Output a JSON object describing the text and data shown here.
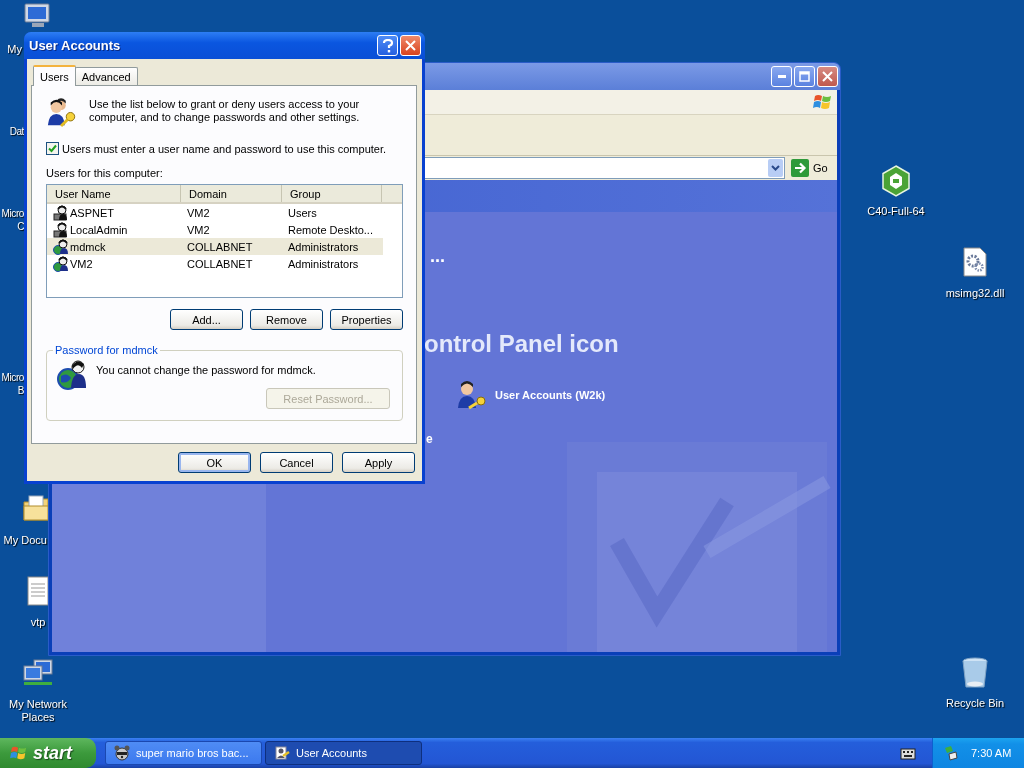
{
  "desktop": {
    "left_icons": [
      {
        "kind": "computer",
        "lines": [
          "My"
        ]
      },
      {
        "lines": [
          "Dat"
        ]
      },
      {
        "lines": [
          "Micro",
          "C"
        ]
      },
      {
        "lines": [
          "Micro",
          "B"
        ]
      },
      {
        "kind": "folder",
        "lines": [
          "My Docu"
        ]
      },
      {
        "kind": "document",
        "lines": [
          "vtp"
        ]
      },
      {
        "kind": "network",
        "lines": [
          "My Network",
          "Places"
        ]
      }
    ],
    "right_icons": [
      {
        "kind": "hexagon",
        "lines": [
          "C40-Full-64"
        ]
      },
      {
        "kind": "dll",
        "lines": [
          "msimg32.dll"
        ]
      },
      {
        "kind": "recycle",
        "lines": [
          "Recycle Bin"
        ]
      }
    ]
  },
  "background_window": {
    "go_button": "Go",
    "content": {
      "fragment_top": "...",
      "heading": "ontrol Panel icon",
      "link": "User Accounts (W2k)",
      "fragment_bottom": "e"
    }
  },
  "dialog": {
    "title": "User Accounts",
    "tabs": [
      {
        "label": "Users",
        "selected": true
      },
      {
        "label": "Advanced",
        "selected": false
      }
    ],
    "intro": "Use the list below to grant or deny users access to your computer, and to change passwords and other settings.",
    "require_login": {
      "label": "Users must enter a user name and password to use this computer.",
      "checked": true
    },
    "list_label": "Users for this computer:",
    "table": {
      "columns": [
        "User Name",
        "Domain",
        "Group"
      ],
      "rows": [
        {
          "kind": "local",
          "cells": [
            "ASPNET",
            "VM2",
            "Users"
          ],
          "selected": false
        },
        {
          "kind": "local",
          "cells": [
            "LocalAdmin",
            "VM2",
            "Remote Deskto..."
          ],
          "selected": false
        },
        {
          "kind": "domain",
          "cells": [
            "mdmck",
            "COLLABNET",
            "Administrators"
          ],
          "selected": true
        },
        {
          "kind": "domain",
          "cells": [
            "VM2",
            "COLLABNET",
            "Administrators"
          ],
          "selected": false
        }
      ]
    },
    "list_buttons": [
      "Add...",
      "Remove",
      "Properties"
    ],
    "password_group": {
      "title": "Password for mdmck",
      "message": "You cannot change the password for mdmck.",
      "reset_button": {
        "label": "Reset Password...",
        "disabled": true
      }
    },
    "buttons": [
      {
        "label": "OK",
        "default": true
      },
      {
        "label": "Cancel",
        "default": false
      },
      {
        "label": "Apply",
        "default": false
      }
    ]
  },
  "taskbar": {
    "start": "start",
    "tasks": [
      {
        "kind": "game",
        "label": "super mario bros bac...",
        "selected": false
      },
      {
        "kind": "accounts",
        "label": "User Accounts",
        "selected": true
      }
    ],
    "clock": "7:30 AM"
  }
}
